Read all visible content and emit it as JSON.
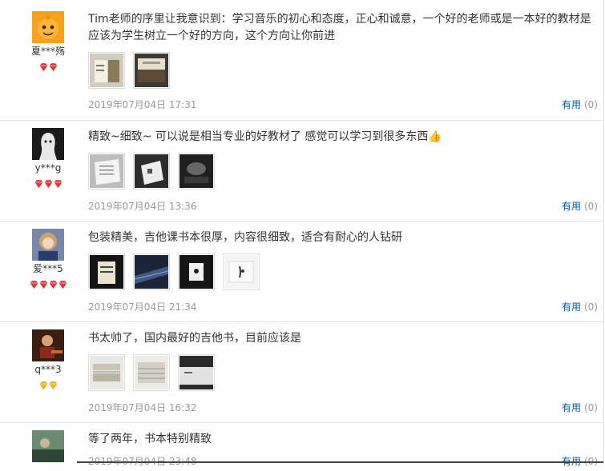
{
  "reviews": [
    {
      "user": "夏***殇",
      "gem_count": 2,
      "gem_color": "#e4393c",
      "text": "Tim老师的序里让我意识到：学习音乐的初心和态度，正心和诚意，一个好的老师或是一本好的教材是应该为学生树立一个好的方向，这个方向让你前进",
      "images": [
        "photo-icon",
        "photo-icon"
      ],
      "date": "2019年07月04日 17:31",
      "useful_label": "有用",
      "useful_count": "(0)"
    },
    {
      "user": "y***g",
      "gem_count": 3,
      "gem_color": "#e4393c",
      "text": "精致~细致~ 可以说是相当专业的好教材了 感觉可以学习到很多东西👍",
      "images": [
        "photo-icon",
        "photo-icon",
        "photo-icon"
      ],
      "date": "2019年07月04日 13:36",
      "useful_label": "有用",
      "useful_count": "(0)"
    },
    {
      "user": "爱***5",
      "gem_count": 4,
      "gem_color": "#e4393c",
      "text": "包装精美，吉他课书本很厚，内容很细致，适合有耐心的人钻研",
      "images": [
        "photo-icon",
        "photo-icon",
        "photo-icon",
        "photo-icon"
      ],
      "date": "2019年07月04日 21:34",
      "useful_label": "有用",
      "useful_count": "(0)"
    },
    {
      "user": "q***3",
      "gem_count": 2,
      "gem_color": "#f2b81b",
      "text": "书太帅了，国内最好的吉他书，目前应该是",
      "images": [
        "photo-icon",
        "photo-icon",
        "photo-icon"
      ],
      "date": "2019年07月04日 16:32",
      "useful_label": "有用",
      "useful_count": "(0)"
    },
    {
      "user": "",
      "gem_count": 0,
      "gem_color": "#e4393c",
      "text": "等了两年，书本特别精致",
      "images": [],
      "date": "2019年07月04日 23:48",
      "useful_label": "有用",
      "useful_count": "(0)"
    }
  ]
}
